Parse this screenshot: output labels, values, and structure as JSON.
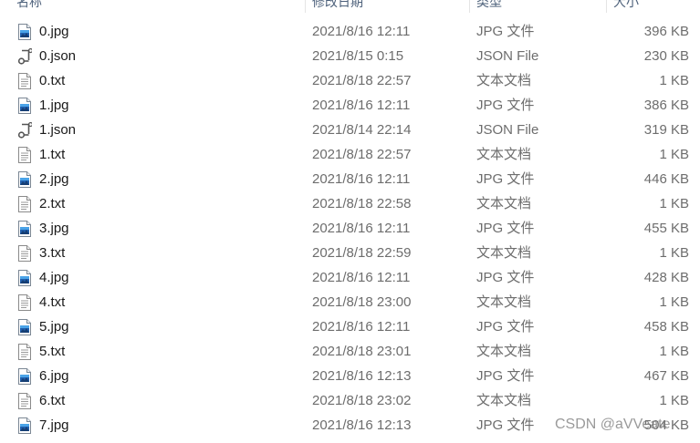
{
  "header": {
    "columns": [
      {
        "label": "名称"
      },
      {
        "label": "修改日期"
      },
      {
        "label": "类型"
      },
      {
        "label": "大小"
      }
    ]
  },
  "files": [
    {
      "name": "0.jpg",
      "date": "2021/8/16 12:11",
      "type": "JPG 文件",
      "size": "396 KB",
      "icon": "jpg-icon"
    },
    {
      "name": "0.json",
      "date": "2021/8/15 0:15",
      "type": "JSON File",
      "size": "230 KB",
      "icon": "json-icon"
    },
    {
      "name": "0.txt",
      "date": "2021/8/18 22:57",
      "type": "文本文档",
      "size": "1 KB",
      "icon": "txt-icon"
    },
    {
      "name": "1.jpg",
      "date": "2021/8/16 12:11",
      "type": "JPG 文件",
      "size": "386 KB",
      "icon": "jpg-icon"
    },
    {
      "name": "1.json",
      "date": "2021/8/14 22:14",
      "type": "JSON File",
      "size": "319 KB",
      "icon": "json-icon"
    },
    {
      "name": "1.txt",
      "date": "2021/8/18 22:57",
      "type": "文本文档",
      "size": "1 KB",
      "icon": "txt-icon"
    },
    {
      "name": "2.jpg",
      "date": "2021/8/16 12:11",
      "type": "JPG 文件",
      "size": "446 KB",
      "icon": "jpg-icon"
    },
    {
      "name": "2.txt",
      "date": "2021/8/18 22:58",
      "type": "文本文档",
      "size": "1 KB",
      "icon": "txt-icon"
    },
    {
      "name": "3.jpg",
      "date": "2021/8/16 12:11",
      "type": "JPG 文件",
      "size": "455 KB",
      "icon": "jpg-icon"
    },
    {
      "name": "3.txt",
      "date": "2021/8/18 22:59",
      "type": "文本文档",
      "size": "1 KB",
      "icon": "txt-icon"
    },
    {
      "name": "4.jpg",
      "date": "2021/8/16 12:11",
      "type": "JPG 文件",
      "size": "428 KB",
      "icon": "jpg-icon"
    },
    {
      "name": "4.txt",
      "date": "2021/8/18 23:00",
      "type": "文本文档",
      "size": "1 KB",
      "icon": "txt-icon"
    },
    {
      "name": "5.jpg",
      "date": "2021/8/16 12:11",
      "type": "JPG 文件",
      "size": "458 KB",
      "icon": "jpg-icon"
    },
    {
      "name": "5.txt",
      "date": "2021/8/18 23:01",
      "type": "文本文档",
      "size": "1 KB",
      "icon": "txt-icon"
    },
    {
      "name": "6.jpg",
      "date": "2021/8/16 12:13",
      "type": "JPG 文件",
      "size": "467 KB",
      "icon": "jpg-icon"
    },
    {
      "name": "6.txt",
      "date": "2021/8/18 23:02",
      "type": "文本文档",
      "size": "1 KB",
      "icon": "txt-icon"
    },
    {
      "name": "7.jpg",
      "date": "2021/8/16 12:13",
      "type": "JPG 文件",
      "size": "504 KB",
      "icon": "jpg-icon"
    }
  ],
  "watermark": "CSDN @aVVeate"
}
